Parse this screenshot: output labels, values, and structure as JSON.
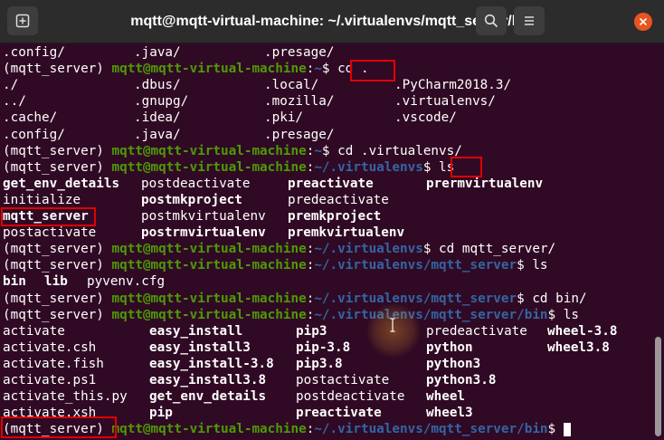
{
  "window": {
    "title": "mqtt@mqtt-virtual-machine: ~/.virtualenvs/mqtt_server/bin"
  },
  "icons": {
    "new_tab": "new-tab-icon",
    "search": "search-icon",
    "menu": "hamburger-menu-icon",
    "close": "close-icon"
  },
  "colors": {
    "background": "#300a24",
    "prompt_user": "#4e9a06",
    "prompt_path": "#3465a4",
    "highlight_box": "#e00000",
    "titlebar": "#2c2c2c",
    "close_button": "#e95420"
  },
  "terminal": {
    "env": "(mqtt_server)",
    "user_host": "mqtt@mqtt-virtual-machine",
    "lines": [
      {
        "type": "cols",
        "cells": [
          ".config/",
          ".java/",
          ".presage/"
        ]
      },
      {
        "type": "prompt",
        "path": "~",
        "cmd": "cd ."
      },
      {
        "type": "cols",
        "cells": [
          "./",
          ".dbus/",
          ".local/",
          ".PyCharm2018.3/"
        ]
      },
      {
        "type": "cols",
        "cells": [
          "../",
          ".gnupg/",
          ".mozilla/",
          ".virtualenvs/"
        ]
      },
      {
        "type": "cols",
        "cells": [
          ".cache/",
          ".idea/",
          ".pki/",
          ".vscode/"
        ]
      },
      {
        "type": "cols",
        "cells": [
          ".config/",
          ".java/",
          ".presage/"
        ]
      },
      {
        "type": "prompt",
        "path": "~",
        "cmd": "cd .virtualenvs/"
      },
      {
        "type": "prompt",
        "path": "~/.virtualenvs",
        "cmd": "ls"
      },
      {
        "type": "cols",
        "cells": [
          "get_env_details",
          "postdeactivate",
          "preactivate",
          "prermvirtualenv"
        ]
      },
      {
        "type": "cols",
        "cells": [
          "initialize",
          "postmkproject",
          "predeactivate"
        ]
      },
      {
        "type": "cols",
        "cells": [
          "mqtt_server",
          "postmkvirtualenv",
          "premkproject"
        ]
      },
      {
        "type": "cols",
        "cells": [
          "postactivate",
          "postrmvirtualenv",
          "premkvirtualenv"
        ]
      },
      {
        "type": "prompt",
        "path": "~/.virtualenvs",
        "cmd": "cd mqtt_server/"
      },
      {
        "type": "prompt",
        "path": "~/.virtualenvs/mqtt_server",
        "cmd": "ls"
      },
      {
        "type": "cols",
        "cells": [
          "bin",
          "lib",
          "pyvenv.cfg"
        ]
      },
      {
        "type": "prompt",
        "path": "~/.virtualenvs/mqtt_server",
        "cmd": "cd bin/"
      },
      {
        "type": "prompt",
        "path": "~/.virtualenvs/mqtt_server/bin",
        "cmd": "ls"
      },
      {
        "type": "cols",
        "cells": [
          "activate",
          "easy_install",
          "pip3",
          "predeactivate",
          "wheel-3.8"
        ]
      },
      {
        "type": "cols",
        "cells": [
          "activate.csh",
          "easy_install3",
          "pip-3.8",
          "python",
          "wheel3.8"
        ]
      },
      {
        "type": "cols",
        "cells": [
          "activate.fish",
          "easy_install-3.8",
          "pip3.8",
          "python3"
        ]
      },
      {
        "type": "cols",
        "cells": [
          "activate.ps1",
          "easy_install3.8",
          "postactivate",
          "python3.8"
        ]
      },
      {
        "type": "cols",
        "cells": [
          "activate_this.py",
          "get_env_details",
          "postdeactivate",
          "wheel"
        ]
      },
      {
        "type": "cols",
        "cells": [
          "activate.xsh",
          "pip",
          "preactivate",
          "wheel3"
        ]
      },
      {
        "type": "prompt",
        "path": "~/.virtualenvs/mqtt_server/bin",
        "cmd": ""
      }
    ]
  }
}
